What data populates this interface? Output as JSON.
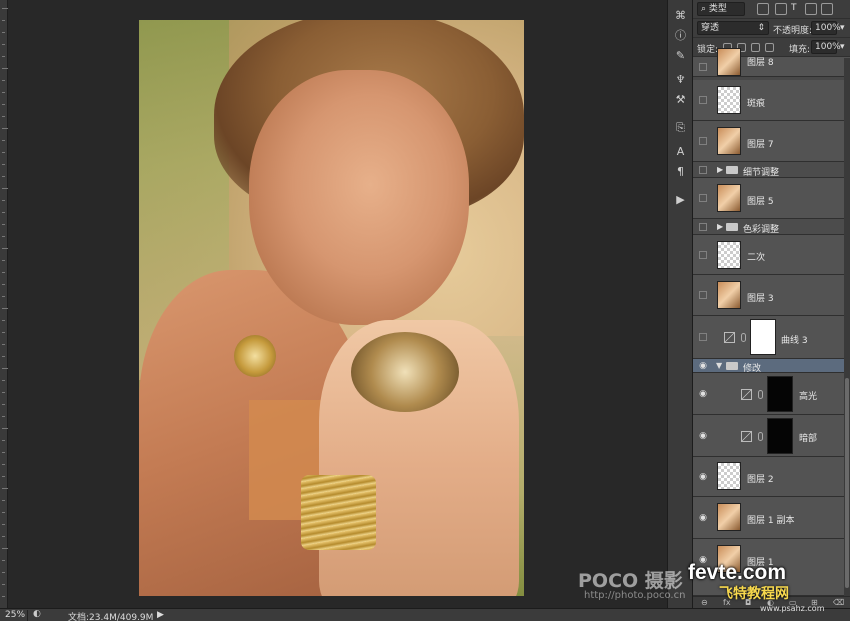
{
  "options": {
    "kind_filter": "类型",
    "blend_mode": "穿透",
    "opacity_label": "不透明度:",
    "opacity_value": "100%",
    "lock_label": "锁定:",
    "fill_label": "填充:",
    "fill_value": "100%"
  },
  "layers": [
    {
      "name": "图层 8",
      "visible": false,
      "thumb": "photo"
    },
    {
      "name": "斑痕",
      "visible": false,
      "thumb": "trans"
    },
    {
      "name": "图层 7",
      "visible": false,
      "thumb": "photo"
    },
    {
      "name": "细节调整",
      "visible": false,
      "type": "group",
      "collapsed": true
    },
    {
      "name": "图层 5",
      "visible": false,
      "thumb": "photo"
    },
    {
      "name": "色彩调整",
      "visible": false,
      "type": "group",
      "collapsed": true
    },
    {
      "name": "二次",
      "visible": false,
      "thumb": "trans"
    },
    {
      "name": "图层 3",
      "visible": false,
      "thumb": "photo"
    },
    {
      "name": "曲线 3",
      "visible": false,
      "type": "adjustment",
      "mask": "white"
    },
    {
      "name": "修改",
      "visible": true,
      "type": "group",
      "collapsed": false,
      "selected": true
    },
    {
      "name": "高光",
      "visible": true,
      "type": "adjustment",
      "mask": "black",
      "indent": true
    },
    {
      "name": "暗部",
      "visible": true,
      "type": "adjustment",
      "mask": "black",
      "indent": true
    },
    {
      "name": "图层 2",
      "visible": true,
      "thumb": "trans"
    },
    {
      "name": "图层 1 副本",
      "visible": true,
      "thumb": "photo"
    },
    {
      "name": "图层 1",
      "visible": true,
      "thumb": "photo"
    }
  ],
  "status": {
    "zoom": "25%",
    "doc_size": "文档:23.4M/409.9M"
  },
  "watermarks": {
    "poco": "POCO 摄影",
    "poco_url": "http://photo.poco.cn",
    "fevte": "fevte.com",
    "fevte_sub": "飞特教程网",
    "psahz": "www.psahz.com"
  },
  "icons": {
    "visibility": "eye-icon",
    "tools": [
      "history-icon",
      "info-icon",
      "brush-icon",
      "adjust-icon",
      "clone-icon",
      "character-icon",
      "paragraph-icon",
      "play-icon"
    ]
  }
}
